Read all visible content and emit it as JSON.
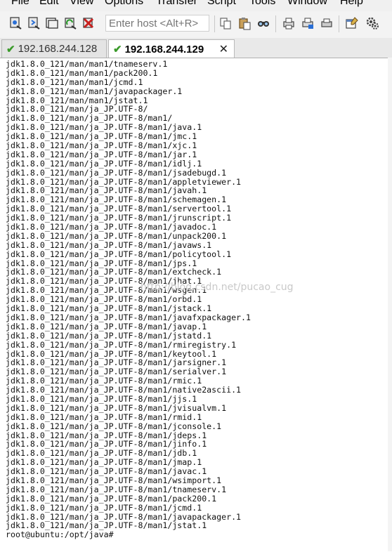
{
  "menu": [
    "File",
    "Edit",
    "View",
    "Options",
    "Transfer",
    "Script",
    "Tools",
    "Window",
    "Help"
  ],
  "toolbar": {
    "host_placeholder": "Enter host <Alt+R>",
    "icons": [
      "connect-icon",
      "quick-connect-icon",
      "connect-in-tab-icon",
      "reconnect-icon",
      "disconnect-icon",
      "copy-icon",
      "paste-icon",
      "find-icon",
      "print-icon",
      "print-setup-icon",
      "print-screen-icon",
      "session-options-icon",
      "global-options-icon"
    ]
  },
  "tabs": [
    {
      "label": "192.168.244.128",
      "active": false
    },
    {
      "label": "192.168.244.129",
      "active": true
    }
  ],
  "terminal": {
    "watermark": "http://blog.csdn.net/pucao_cug",
    "lines": [
      "jdk1.8.0_121/man/man1/tnameserv.1",
      "jdk1.8.0_121/man/man1/pack200.1",
      "jdk1.8.0_121/man/man1/jcmd.1",
      "jdk1.8.0_121/man/man1/javapackager.1",
      "jdk1.8.0_121/man/man1/jstat.1",
      "jdk1.8.0_121/man/ja_JP.UTF-8/",
      "jdk1.8.0_121/man/ja_JP.UTF-8/man1/",
      "jdk1.8.0_121/man/ja_JP.UTF-8/man1/java.1",
      "jdk1.8.0_121/man/ja_JP.UTF-8/man1/jmc.1",
      "jdk1.8.0_121/man/ja_JP.UTF-8/man1/xjc.1",
      "jdk1.8.0_121/man/ja_JP.UTF-8/man1/jar.1",
      "jdk1.8.0_121/man/ja_JP.UTF-8/man1/idlj.1",
      "jdk1.8.0_121/man/ja_JP.UTF-8/man1/jsadebugd.1",
      "jdk1.8.0_121/man/ja_JP.UTF-8/man1/appletviewer.1",
      "jdk1.8.0_121/man/ja_JP.UTF-8/man1/javah.1",
      "jdk1.8.0_121/man/ja_JP.UTF-8/man1/schemagen.1",
      "jdk1.8.0_121/man/ja_JP.UTF-8/man1/servertool.1",
      "jdk1.8.0_121/man/ja_JP.UTF-8/man1/jrunscript.1",
      "jdk1.8.0_121/man/ja_JP.UTF-8/man1/javadoc.1",
      "jdk1.8.0_121/man/ja_JP.UTF-8/man1/unpack200.1",
      "jdk1.8.0_121/man/ja_JP.UTF-8/man1/javaws.1",
      "jdk1.8.0_121/man/ja_JP.UTF-8/man1/policytool.1",
      "jdk1.8.0_121/man/ja_JP.UTF-8/man1/jps.1",
      "jdk1.8.0_121/man/ja_JP.UTF-8/man1/extcheck.1",
      "jdk1.8.0_121/man/ja_JP.UTF-8/man1/jhat.1",
      "jdk1.8.0_121/man/ja_JP.UTF-8/man1/wsgen.1",
      "jdk1.8.0_121/man/ja_JP.UTF-8/man1/orbd.1",
      "jdk1.8.0_121/man/ja_JP.UTF-8/man1/jstack.1",
      "jdk1.8.0_121/man/ja_JP.UTF-8/man1/javafxpackager.1",
      "jdk1.8.0_121/man/ja_JP.UTF-8/man1/javap.1",
      "jdk1.8.0_121/man/ja_JP.UTF-8/man1/jstatd.1",
      "jdk1.8.0_121/man/ja_JP.UTF-8/man1/rmiregistry.1",
      "jdk1.8.0_121/man/ja_JP.UTF-8/man1/keytool.1",
      "jdk1.8.0_121/man/ja_JP.UTF-8/man1/jarsigner.1",
      "jdk1.8.0_121/man/ja_JP.UTF-8/man1/serialver.1",
      "jdk1.8.0_121/man/ja_JP.UTF-8/man1/rmic.1",
      "jdk1.8.0_121/man/ja_JP.UTF-8/man1/native2ascii.1",
      "jdk1.8.0_121/man/ja_JP.UTF-8/man1/jjs.1",
      "jdk1.8.0_121/man/ja_JP.UTF-8/man1/jvisualvm.1",
      "jdk1.8.0_121/man/ja_JP.UTF-8/man1/rmid.1",
      "jdk1.8.0_121/man/ja_JP.UTF-8/man1/jconsole.1",
      "jdk1.8.0_121/man/ja_JP.UTF-8/man1/jdeps.1",
      "jdk1.8.0_121/man/ja_JP.UTF-8/man1/jinfo.1",
      "jdk1.8.0_121/man/ja_JP.UTF-8/man1/jdb.1",
      "jdk1.8.0_121/man/ja_JP.UTF-8/man1/jmap.1",
      "jdk1.8.0_121/man/ja_JP.UTF-8/man1/javac.1",
      "jdk1.8.0_121/man/ja_JP.UTF-8/man1/wsimport.1",
      "jdk1.8.0_121/man/ja_JP.UTF-8/man1/tnameserv.1",
      "jdk1.8.0_121/man/ja_JP.UTF-8/man1/pack200.1",
      "jdk1.8.0_121/man/ja_JP.UTF-8/man1/jcmd.1",
      "jdk1.8.0_121/man/ja_JP.UTF-8/man1/javapackager.1",
      "jdk1.8.0_121/man/ja_JP.UTF-8/man1/jstat.1",
      "root@ubuntu:/opt/java#"
    ]
  }
}
